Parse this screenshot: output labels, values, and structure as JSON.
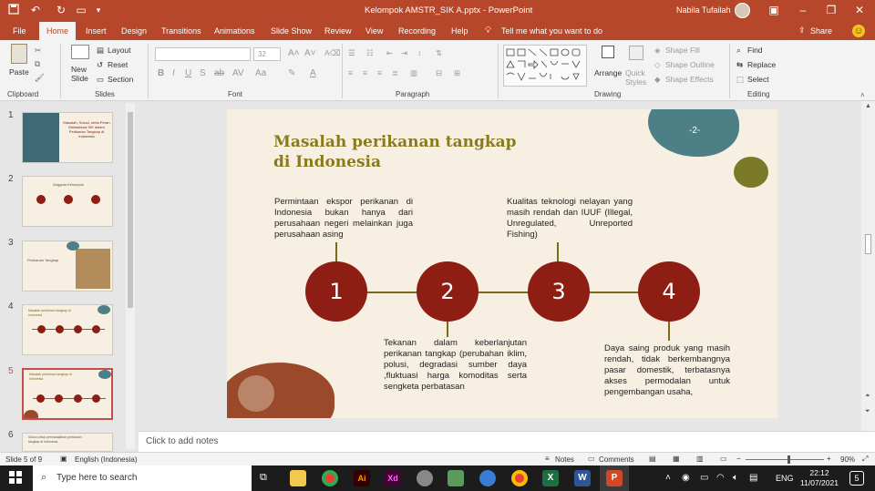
{
  "window": {
    "title": "Kelompok AMSTR_SIK A.pptx  -  PowerPoint",
    "user": "Nabila Tufailah",
    "emoji": "☺"
  },
  "tabs": [
    "File",
    "Home",
    "Insert",
    "Design",
    "Transitions",
    "Animations",
    "Slide Show",
    "Review",
    "View",
    "Recording",
    "Help"
  ],
  "tell_me": "Tell me what you want to do",
  "share": "Share",
  "ribbon": {
    "paste": "Paste",
    "new_slide": "New Slide",
    "layout": "Layout",
    "reset": "Reset",
    "section": "Section",
    "font_size": "32",
    "arrange": "Arrange",
    "quick_styles": "Quick Styles",
    "shape_fill": "Shape Fill",
    "shape_outline": "Shape Outline",
    "shape_effects": "Shape Effects",
    "find": "Find",
    "replace": "Replace",
    "select": "Select",
    "groups": {
      "clipboard": "Clipboard",
      "slides": "Slides",
      "font": "Font",
      "paragraph": "Paragraph",
      "drawing": "Drawing",
      "editing": "Editing"
    }
  },
  "thumbnails": {
    "numbers": [
      "1",
      "2",
      "3",
      "4",
      "5",
      "6"
    ],
    "t1_title": "Masalah, Solusi, serta Peran Mahasiswa SIK dalam Perikanan Tangkap di Indonesia",
    "t2_title": "Anggota Kelompok",
    "t3_title": "Perikanan Tangkap",
    "t4_title": "Masalah perikanan tangkap di Indonesia",
    "t5_title": "Masalah perikanan tangkap di Indonesia",
    "t6_title": "Solusi untuk permasalahan perikanan tangkap di Indonesia"
  },
  "slide": {
    "page_number": "-2-",
    "title_line1": "Masalah perikanan tangkap",
    "title_line2": "di Indonesia",
    "box1": "Permintaan ekspor perikanan di Indonesia bukan hanya dari perusahaan negeri melainkan juga perusahaan asing",
    "box2": "Tekanan dalam keberlanjutan perikanan tangkap (perubahan iklim, polusi, degradasi sumber daya ,fluktuasi harga komoditas serta sengketa perbatasan",
    "box3": "Kualitas teknologi nelayan yang masih rendah dan IUUF (Illegal, Unregulated, Unreported Fishing)",
    "box4": "Daya saing produk yang masih rendah, tidak berkembangnya pasar domestik, terbatasnya akses permodalan untuk pengembangan usaha,",
    "circles": [
      "1",
      "2",
      "3",
      "4"
    ]
  },
  "notes_placeholder": "Click to add notes",
  "status": {
    "slide_info": "Slide 5 of 9",
    "language": "English (Indonesia)",
    "notes": "Notes",
    "comments": "Comments",
    "zoom": "90%"
  },
  "taskbar": {
    "search": "Type here to search",
    "lang": "ENG",
    "time": "22:12",
    "date": "11/07/2021",
    "notif": "5"
  },
  "colors": {
    "accent": "#b7472a",
    "slide_bg": "#f7f0e2",
    "circle": "#8e1d14",
    "title": "#8a7a1c",
    "teal_blob": "#4d7f86",
    "olive_blob": "#7a7a28",
    "brown_blob": "#9a4a2a"
  }
}
